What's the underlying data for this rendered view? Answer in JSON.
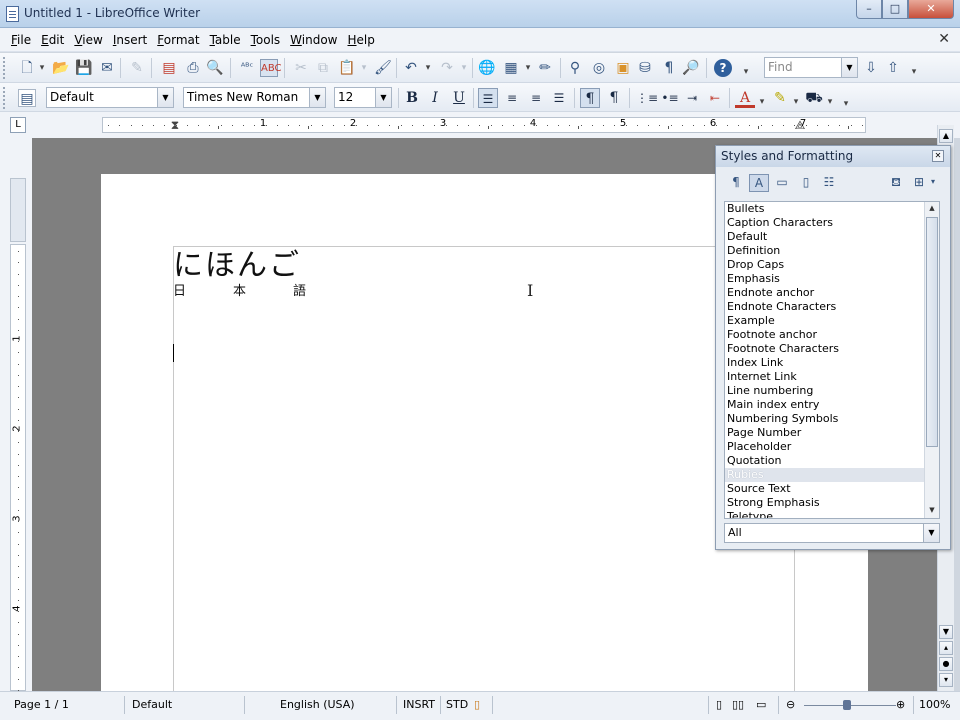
{
  "window": {
    "title": "Untitled 1 - LibreOffice Writer",
    "min": "–",
    "max": "□",
    "close": "✕"
  },
  "menu": [
    "File",
    "Edit",
    "View",
    "Insert",
    "Format",
    "Table",
    "Tools",
    "Window",
    "Help"
  ],
  "menu_close": "✕",
  "toolbar": {
    "find_placeholder": "Find",
    "paragraph_style": "Default",
    "font_name": "Times New Roman",
    "font_size": "12",
    "bold": "B",
    "italic": "I",
    "underline": "U"
  },
  "ruler": {
    "numbers": [
      "1",
      "2",
      "3",
      "4",
      "5",
      "6",
      "7"
    ],
    "vnumbers": [
      "1",
      "2",
      "3",
      "4"
    ],
    "tab_button": "L"
  },
  "document": {
    "ruby_text": "にほんご",
    "base_chars": [
      "日",
      "本",
      "語"
    ]
  },
  "styles_panel": {
    "title": "Styles and Formatting",
    "items": [
      "Bullets",
      "Caption Characters",
      "Default",
      "Definition",
      "Drop Caps",
      "Emphasis",
      "Endnote anchor",
      "Endnote Characters",
      "Example",
      "Footnote anchor",
      "Footnote Characters",
      "Index Link",
      "Internet Link",
      "Line numbering",
      "Main index entry",
      "Numbering Symbols",
      "Page Number",
      "Placeholder",
      "Quotation",
      "Rubies",
      "Source Text",
      "Strong Emphasis",
      "Teletype"
    ],
    "selected": "Rubies",
    "filter": "All"
  },
  "status": {
    "page": "Page 1 / 1",
    "page_style": "Default",
    "language": "English (USA)",
    "insert_mode": "INSRT",
    "selection_mode": "STD",
    "zoom": "100%"
  }
}
